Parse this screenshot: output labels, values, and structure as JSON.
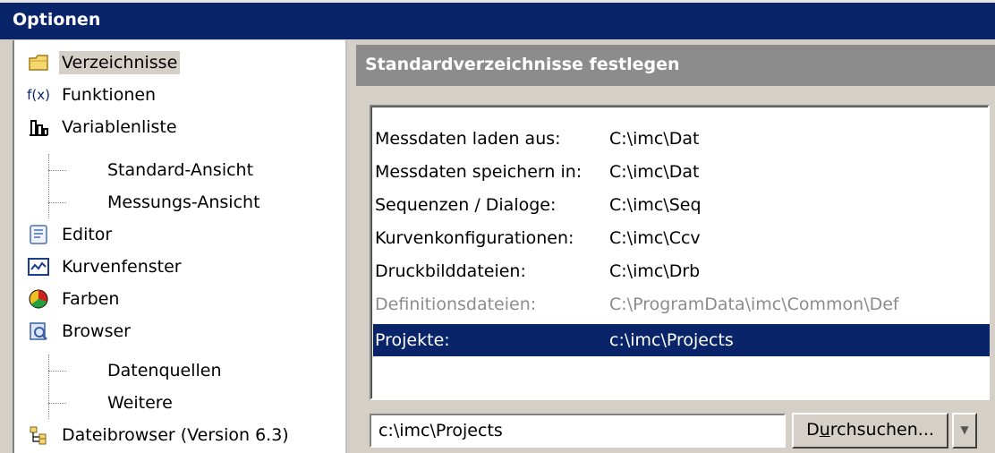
{
  "window": {
    "title": "Optionen"
  },
  "tree": {
    "items": [
      {
        "label": "Verzeichnisse",
        "icon": "folder-icon",
        "selected": true
      },
      {
        "label": "Funktionen",
        "icon": "function-icon"
      },
      {
        "label": "Variablenliste",
        "icon": "variable-list-icon"
      },
      {
        "label": "Standard-Ansicht",
        "child": true
      },
      {
        "label": "Messungs-Ansicht",
        "child": true
      },
      {
        "label": "Editor",
        "icon": "editor-icon"
      },
      {
        "label": "Kurvenfenster",
        "icon": "curve-window-icon"
      },
      {
        "label": "Farben",
        "icon": "colors-icon"
      },
      {
        "label": "Browser",
        "icon": "browser-icon"
      },
      {
        "label": "Datenquellen",
        "child": true
      },
      {
        "label": "Weitere",
        "child": true
      },
      {
        "label": "Dateibrowser (Version 6.3)",
        "icon": "file-browser-icon"
      }
    ]
  },
  "panel": {
    "title": "Standardverzeichnisse festlegen"
  },
  "dirs": {
    "rows": [
      {
        "key": "Messdaten laden aus:",
        "value": "C:\\imc\\Dat"
      },
      {
        "key": "Messdaten speichern in:",
        "value": "C:\\imc\\Dat"
      },
      {
        "key": "Sequenzen / Dialoge:",
        "value": "C:\\imc\\Seq"
      },
      {
        "key": "Kurvenkonfigurationen:",
        "value": "C:\\imc\\Ccv"
      },
      {
        "key": "Druckbilddateien:",
        "value": "C:\\imc\\Drb"
      },
      {
        "key": "Definitionsdateien:",
        "value": "C:\\ProgramData\\imc\\Common\\Def",
        "disabled": true
      },
      {
        "key": "Projekte:",
        "value": "c:\\imc\\Projects",
        "selected": true
      }
    ]
  },
  "path_field": {
    "value": "c:\\imc\\Projects"
  },
  "browse_button": {
    "pre": "D",
    "underlined": "u",
    "post": "rchsuchen..."
  },
  "colors": {
    "titlebar": "#0a246a",
    "selection": "#0a246a",
    "panel_header": "#8c8c8c"
  }
}
